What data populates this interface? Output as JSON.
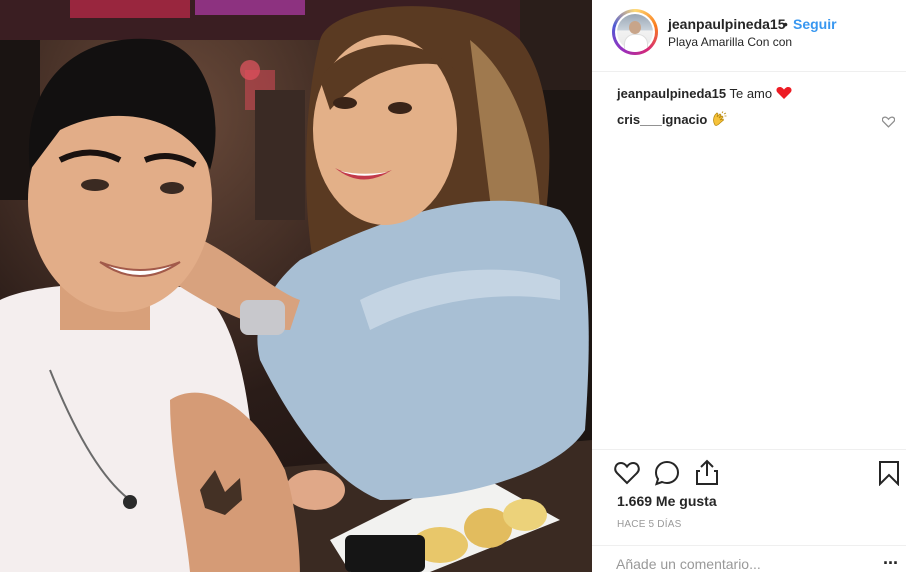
{
  "post": {
    "photo_icon": "selfie-photo",
    "header": {
      "username": "jeanpaulpineda15",
      "separator": "•",
      "follow_label": "Seguir",
      "location": "Playa Amarilla Con con"
    },
    "comments": [
      {
        "user": "jeanpaulpineda15",
        "text": "Te amo",
        "emoji": "red-heart-emoji"
      },
      {
        "user": "cris___ignacio",
        "text": "",
        "emoji": "clapping-hands-emoji"
      }
    ],
    "actions": {
      "icons": [
        "heart-icon",
        "comment-icon",
        "share-icon",
        "bookmark-icon"
      ],
      "likes": "1.669 Me gusta",
      "time": "HACE 5 DÍAS"
    },
    "comment_bar": {
      "placeholder": "Añade un comentario...",
      "more": "..."
    },
    "colors": {
      "accent": "#3897f0",
      "heart": "#ed1c24",
      "text": "#262626",
      "muted": "#999999"
    }
  }
}
